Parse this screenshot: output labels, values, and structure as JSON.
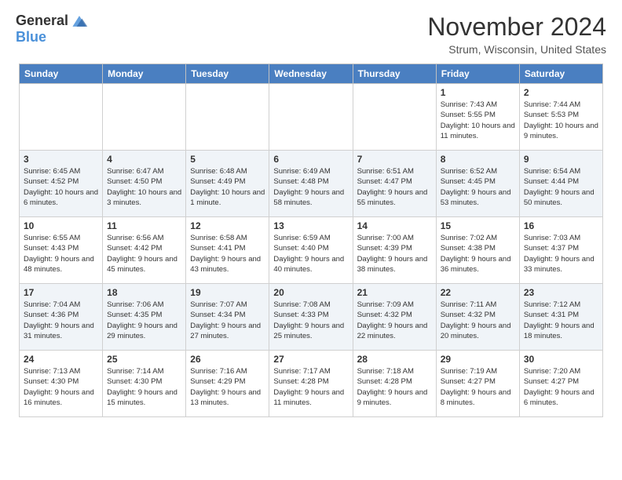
{
  "header": {
    "logo_general": "General",
    "logo_blue": "Blue",
    "month_title": "November 2024",
    "location": "Strum, Wisconsin, United States"
  },
  "calendar": {
    "days_of_week": [
      "Sunday",
      "Monday",
      "Tuesday",
      "Wednesday",
      "Thursday",
      "Friday",
      "Saturday"
    ],
    "weeks": [
      [
        {
          "day": "",
          "info": ""
        },
        {
          "day": "",
          "info": ""
        },
        {
          "day": "",
          "info": ""
        },
        {
          "day": "",
          "info": ""
        },
        {
          "day": "",
          "info": ""
        },
        {
          "day": "1",
          "info": "Sunrise: 7:43 AM\nSunset: 5:55 PM\nDaylight: 10 hours and 11 minutes."
        },
        {
          "day": "2",
          "info": "Sunrise: 7:44 AM\nSunset: 5:53 PM\nDaylight: 10 hours and 9 minutes."
        }
      ],
      [
        {
          "day": "3",
          "info": "Sunrise: 6:45 AM\nSunset: 4:52 PM\nDaylight: 10 hours and 6 minutes."
        },
        {
          "day": "4",
          "info": "Sunrise: 6:47 AM\nSunset: 4:50 PM\nDaylight: 10 hours and 3 minutes."
        },
        {
          "day": "5",
          "info": "Sunrise: 6:48 AM\nSunset: 4:49 PM\nDaylight: 10 hours and 1 minute."
        },
        {
          "day": "6",
          "info": "Sunrise: 6:49 AM\nSunset: 4:48 PM\nDaylight: 9 hours and 58 minutes."
        },
        {
          "day": "7",
          "info": "Sunrise: 6:51 AM\nSunset: 4:47 PM\nDaylight: 9 hours and 55 minutes."
        },
        {
          "day": "8",
          "info": "Sunrise: 6:52 AM\nSunset: 4:45 PM\nDaylight: 9 hours and 53 minutes."
        },
        {
          "day": "9",
          "info": "Sunrise: 6:54 AM\nSunset: 4:44 PM\nDaylight: 9 hours and 50 minutes."
        }
      ],
      [
        {
          "day": "10",
          "info": "Sunrise: 6:55 AM\nSunset: 4:43 PM\nDaylight: 9 hours and 48 minutes."
        },
        {
          "day": "11",
          "info": "Sunrise: 6:56 AM\nSunset: 4:42 PM\nDaylight: 9 hours and 45 minutes."
        },
        {
          "day": "12",
          "info": "Sunrise: 6:58 AM\nSunset: 4:41 PM\nDaylight: 9 hours and 43 minutes."
        },
        {
          "day": "13",
          "info": "Sunrise: 6:59 AM\nSunset: 4:40 PM\nDaylight: 9 hours and 40 minutes."
        },
        {
          "day": "14",
          "info": "Sunrise: 7:00 AM\nSunset: 4:39 PM\nDaylight: 9 hours and 38 minutes."
        },
        {
          "day": "15",
          "info": "Sunrise: 7:02 AM\nSunset: 4:38 PM\nDaylight: 9 hours and 36 minutes."
        },
        {
          "day": "16",
          "info": "Sunrise: 7:03 AM\nSunset: 4:37 PM\nDaylight: 9 hours and 33 minutes."
        }
      ],
      [
        {
          "day": "17",
          "info": "Sunrise: 7:04 AM\nSunset: 4:36 PM\nDaylight: 9 hours and 31 minutes."
        },
        {
          "day": "18",
          "info": "Sunrise: 7:06 AM\nSunset: 4:35 PM\nDaylight: 9 hours and 29 minutes."
        },
        {
          "day": "19",
          "info": "Sunrise: 7:07 AM\nSunset: 4:34 PM\nDaylight: 9 hours and 27 minutes."
        },
        {
          "day": "20",
          "info": "Sunrise: 7:08 AM\nSunset: 4:33 PM\nDaylight: 9 hours and 25 minutes."
        },
        {
          "day": "21",
          "info": "Sunrise: 7:09 AM\nSunset: 4:32 PM\nDaylight: 9 hours and 22 minutes."
        },
        {
          "day": "22",
          "info": "Sunrise: 7:11 AM\nSunset: 4:32 PM\nDaylight: 9 hours and 20 minutes."
        },
        {
          "day": "23",
          "info": "Sunrise: 7:12 AM\nSunset: 4:31 PM\nDaylight: 9 hours and 18 minutes."
        }
      ],
      [
        {
          "day": "24",
          "info": "Sunrise: 7:13 AM\nSunset: 4:30 PM\nDaylight: 9 hours and 16 minutes."
        },
        {
          "day": "25",
          "info": "Sunrise: 7:14 AM\nSunset: 4:30 PM\nDaylight: 9 hours and 15 minutes."
        },
        {
          "day": "26",
          "info": "Sunrise: 7:16 AM\nSunset: 4:29 PM\nDaylight: 9 hours and 13 minutes."
        },
        {
          "day": "27",
          "info": "Sunrise: 7:17 AM\nSunset: 4:28 PM\nDaylight: 9 hours and 11 minutes."
        },
        {
          "day": "28",
          "info": "Sunrise: 7:18 AM\nSunset: 4:28 PM\nDaylight: 9 hours and 9 minutes."
        },
        {
          "day": "29",
          "info": "Sunrise: 7:19 AM\nSunset: 4:27 PM\nDaylight: 9 hours and 8 minutes."
        },
        {
          "day": "30",
          "info": "Sunrise: 7:20 AM\nSunset: 4:27 PM\nDaylight: 9 hours and 6 minutes."
        }
      ]
    ]
  }
}
